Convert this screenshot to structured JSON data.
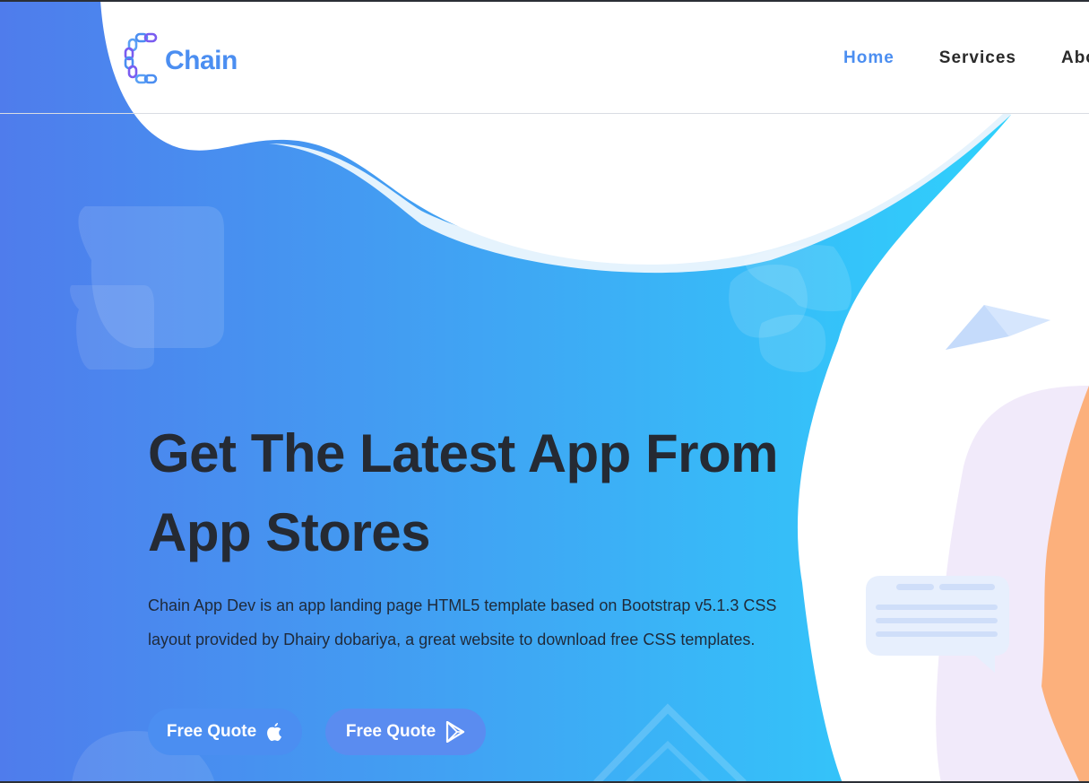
{
  "header": {
    "logo_text": "Chain",
    "nav": [
      {
        "label": "Home",
        "active": true
      },
      {
        "label": "Services",
        "active": false
      },
      {
        "label": "Abo",
        "active": false
      }
    ]
  },
  "hero": {
    "title_line1": "Get The Latest App From",
    "title_line2": "App Stores",
    "desc_line1": "Chain App Dev is an app landing page HTML5 template based on Bootstrap v5.1.3 CSS",
    "desc_line2": "layout provided by Dhairy dobariya, a great website to download free CSS templates.",
    "buttons": [
      {
        "label": "Free Quote",
        "icon": "apple-icon"
      },
      {
        "label": "Free Quote",
        "icon": "play-store-icon"
      }
    ]
  },
  "colors": {
    "accent": "#4b8ef1",
    "gradient_start": "#4f7cec",
    "gradient_end": "#2fd1fc",
    "title_text": "#252a33",
    "illustration_purple": "#f1eafa",
    "illustration_orange": "#fcb07c"
  }
}
